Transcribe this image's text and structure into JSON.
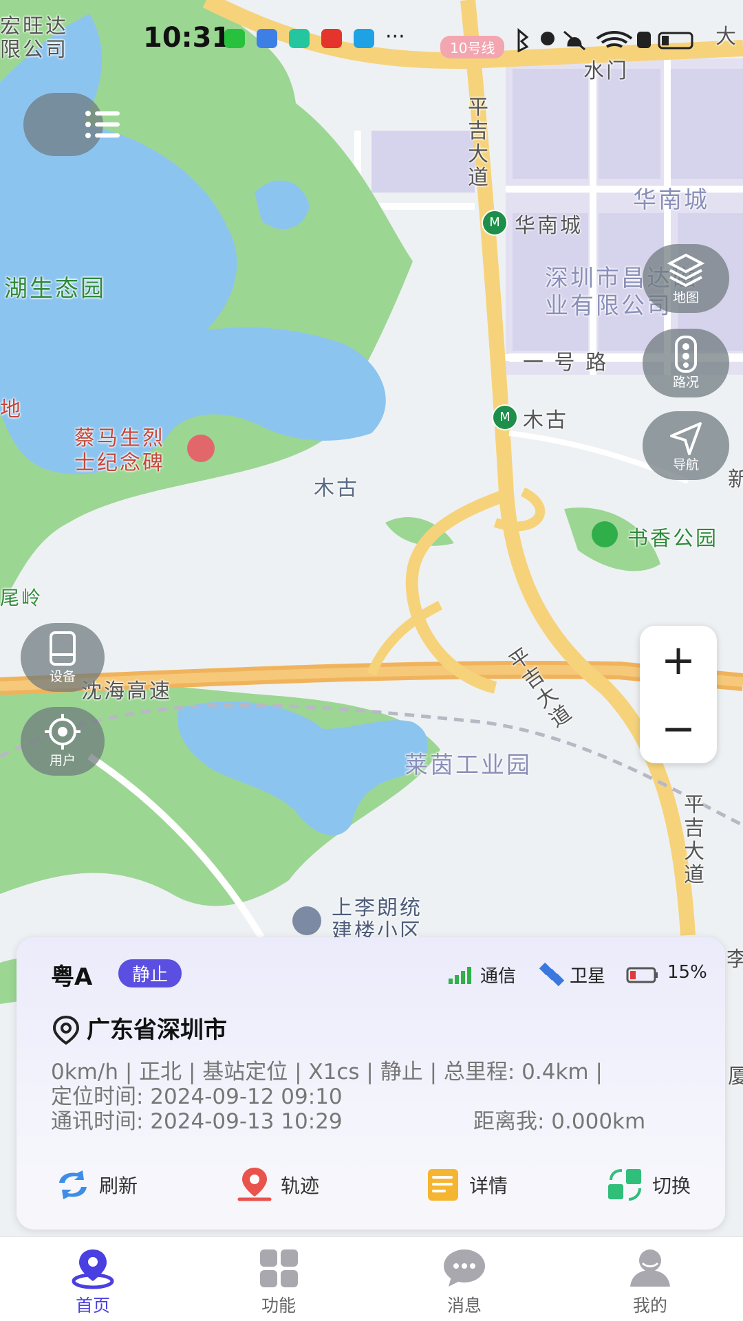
{
  "status_bar": {
    "time": "10:31",
    "metro_line": "10号线",
    "icons": [
      "app-icon",
      "usb-icon",
      "shield-icon",
      "app-icon",
      "browser-icon",
      "more-icon",
      "bluetooth-icon",
      "location-icon",
      "mute-icon",
      "wifi-icon",
      "alert-icon",
      "battery-icon"
    ]
  },
  "map": {
    "labels": {
      "company_top_left": "宏旺达\n限公司",
      "water_gate": "水门",
      "road_pingji_1": "平吉大道",
      "huanan_city_area": "华南城",
      "huanan_city_station": "华南城",
      "eco_park": "湖生态园",
      "company_right": "深圳市昌达磁\n业有限公司",
      "road_yihao": "一 号 路",
      "mugu_station": "木古",
      "mugu_area": "木古",
      "memorial": "蔡马生烈\n士纪念碑",
      "left_edge_char": "地",
      "shuxiang_park": "书香公园",
      "weiling": "尾岭",
      "expressway": "沈海高速",
      "road_pingji_2": "平吉大道",
      "laiyin_park": "莱茵工业园",
      "road_pingji_3": "平吉大道",
      "residential": "上李朗统\n建楼小区",
      "right_edge_1": "大",
      "right_edge_2": "新",
      "right_edge_3": "李",
      "right_edge_4": "厦"
    },
    "controls": {
      "layers": "地图",
      "traffic": "路况",
      "navigation": "导航",
      "device": "设备",
      "user": "用户",
      "zoom_in": "+",
      "zoom_out": "−"
    }
  },
  "vehicle": {
    "plate": "粤A",
    "state": "静止",
    "signal_label": "通信",
    "satellite_label": "卫星",
    "battery": "15%",
    "address": "广东省深圳市",
    "line1": "0km/h | 正北 | 基站定位 | X1cs | 静止 | 总里程: 0.4km |",
    "line2": "定位时间: 2024-09-12 09:10",
    "line3_time": "通讯时间:  2024-09-13 10:29",
    "line3_distance": "距离我:  0.000km",
    "actions": {
      "refresh": "刷新",
      "track": "轨迹",
      "details": "详情",
      "switch": "切换"
    }
  },
  "tabs": {
    "home": "首页",
    "functions": "功能",
    "messages": "消息",
    "mine": "我的"
  },
  "colors": {
    "accent": "#4a3fe0",
    "state_badge": "#5a4fe0",
    "park_green": "#8fd18a",
    "water_blue": "#8cc4f0",
    "road_yellow": "#f6d37a",
    "expressway_orange": "#f0b35c",
    "battery_red": "#e03a3a"
  }
}
